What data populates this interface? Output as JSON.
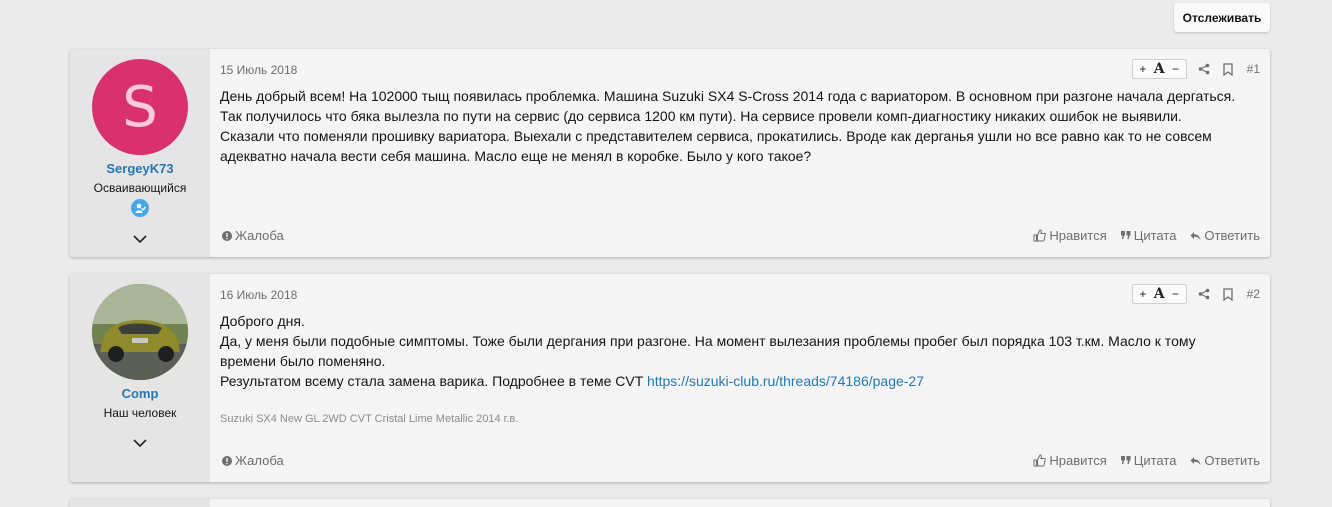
{
  "header": {
    "follow_label": "Отслеживать"
  },
  "posts": [
    {
      "avatar_letter": "S",
      "username": "SergeyK73",
      "user_title": "Осваивающийся",
      "date": "15 Июль 2018",
      "number": "#1",
      "lines": [
        "День добрый всем! На 102000 тыщ появилась проблемка. Машина Suzuki SX4 S-Cross 2014 года с вариатором. В основном при разгоне начала дергаться.",
        "Так получилось что бяка вылезла по пути на сервис (до сервиса 1200 км пути). На сервисе провели комп-диагностику никаких ошибок не выявили.",
        "Сказали что поменяли прошивку вариатора. Выехали с представителем сервиса, прокатились. Вроде как дерганья ушли но все равно как то не совсем",
        "адекватно начала вести себя машина. Масло еще не менял в коробке. Было у кого такое?"
      ],
      "report": "Жалоба",
      "like": "Нравится",
      "quote": "Цитата",
      "reply": "Ответить"
    },
    {
      "username": "Comp",
      "user_title": "Наш человек",
      "date": "16 Июль 2018",
      "number": "#2",
      "lines": [
        "Доброго дня.",
        "Да, у меня были подобные симптомы. Тоже были дергания при разгоне. На момент вылезания проблемы пробег был порядка 103 т.км. Масло к тому",
        "времени было поменяно."
      ],
      "last_line_text": "Результатом всему стала замена варика. Подробнее в теме CVT ",
      "link": "https://suzuki-club.ru/threads/74186/page-27",
      "signature": "Suzuki SX4 New GL 2WD CVT Cristal Lime Metallic 2014 г.в.",
      "report": "Жалоба",
      "like": "Нравится",
      "quote": "Цитата",
      "reply": "Ответить"
    }
  ],
  "font_tool": {
    "plus": "+",
    "letter": "A",
    "minus": "−"
  },
  "colors": {
    "avatar_bg": "#d9306e",
    "link": "#2577b1",
    "badge": "#47a7eb"
  }
}
